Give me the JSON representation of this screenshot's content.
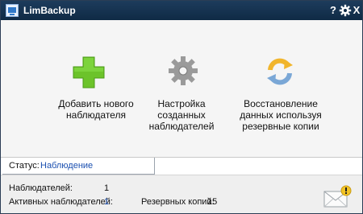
{
  "window": {
    "title": "LimBackup"
  },
  "titlebar": {
    "help_label": "?",
    "close_label": "X",
    "settings_icon": "gear-icon"
  },
  "actions": [
    {
      "label": "Добавить нового\nнаблюдателя",
      "icon": "plus-icon"
    },
    {
      "label": "Настройка созданных\nнаблюдателей",
      "icon": "gear-icon"
    },
    {
      "label": "Восстановление\nданных используя\nрезервные копии",
      "icon": "refresh-icon"
    }
  ],
  "status": {
    "label": "Статус:",
    "value": "Наблюдение"
  },
  "footer": {
    "watchers_label": "Наблюдателей:",
    "watchers_value": "1",
    "active_label": "Активных наблюдателей:",
    "active_value": "1",
    "backups_label": "Резервных копий:",
    "backups_value": "15",
    "mail_icon": "mail-alert-icon"
  },
  "colors": {
    "titlebar": "#0f2a45",
    "accent_link": "#1a4fb0",
    "plus": "#6cc32a",
    "refresh": "#f1b52c"
  }
}
